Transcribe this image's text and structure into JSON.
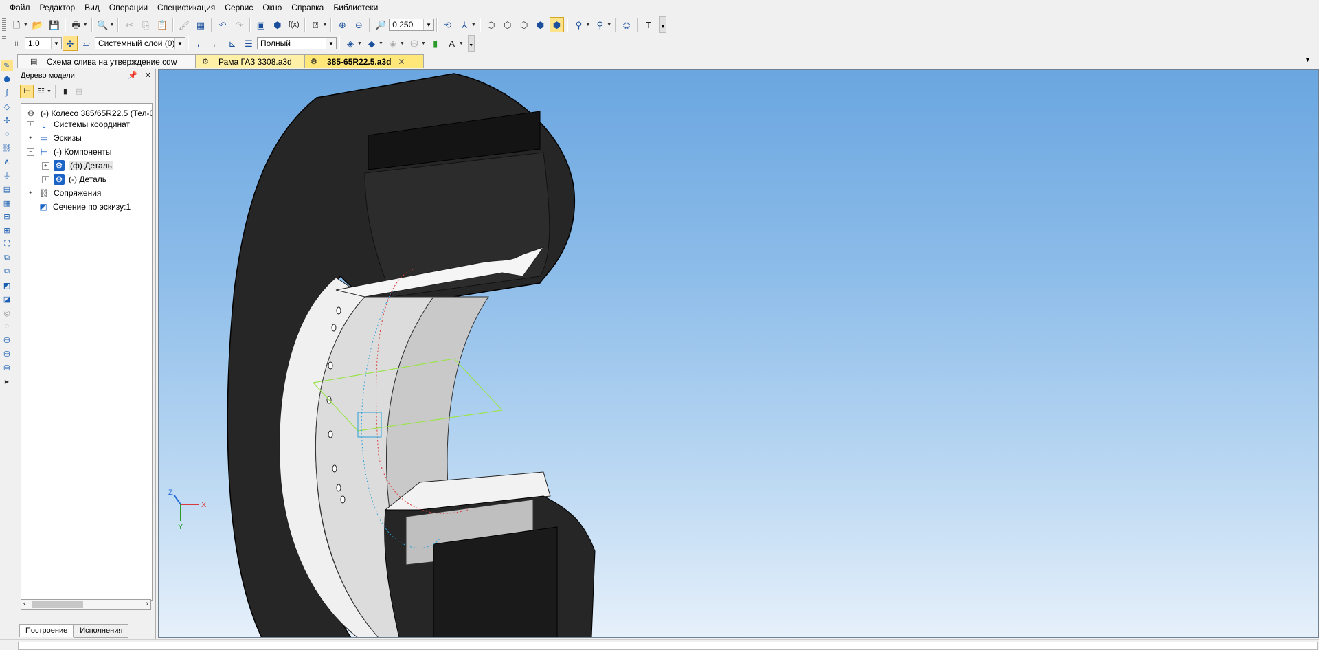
{
  "menu": [
    "Файл",
    "Редактор",
    "Вид",
    "Операции",
    "Спецификация",
    "Сервис",
    "Окно",
    "Справка",
    "Библиотеки"
  ],
  "toolbar1": {
    "zoom_value": "0.250"
  },
  "toolbar2": {
    "step_value": "1.0",
    "layer_value": "Системный слой (0)",
    "style_value": "Полный"
  },
  "doc_tabs": [
    {
      "label": "Схема слива на утверждение.cdw"
    },
    {
      "label": "Рама ГАЗ 3308.a3d"
    },
    {
      "label": "385-65R22.5.a3d",
      "close": "✕"
    }
  ],
  "tree_panel": {
    "title": "Дерево модели",
    "items": [
      {
        "label": "(-) Колесо 385/65R22.5 (Тел-0"
      },
      {
        "label": "Системы координат"
      },
      {
        "label": "Эскизы"
      },
      {
        "label": "(-) Компоненты"
      },
      {
        "label": "(ф) Деталь"
      },
      {
        "label": "(-) Деталь"
      },
      {
        "label": "Сопряжения"
      },
      {
        "label": "Сечение по эскизу:1"
      }
    ],
    "bottom_tabs": [
      "Построение",
      "Исполнения"
    ]
  },
  "axes": {
    "x": "X",
    "y": "Y",
    "z": "Z"
  },
  "colors": {
    "viewport_top": "#6aa6e0",
    "viewport_bottom": "#e6f0fa",
    "active_tab": "#ffe77a",
    "tire": "#262626",
    "rim": "#e9e9e9",
    "section_plane": "#9be34b"
  }
}
